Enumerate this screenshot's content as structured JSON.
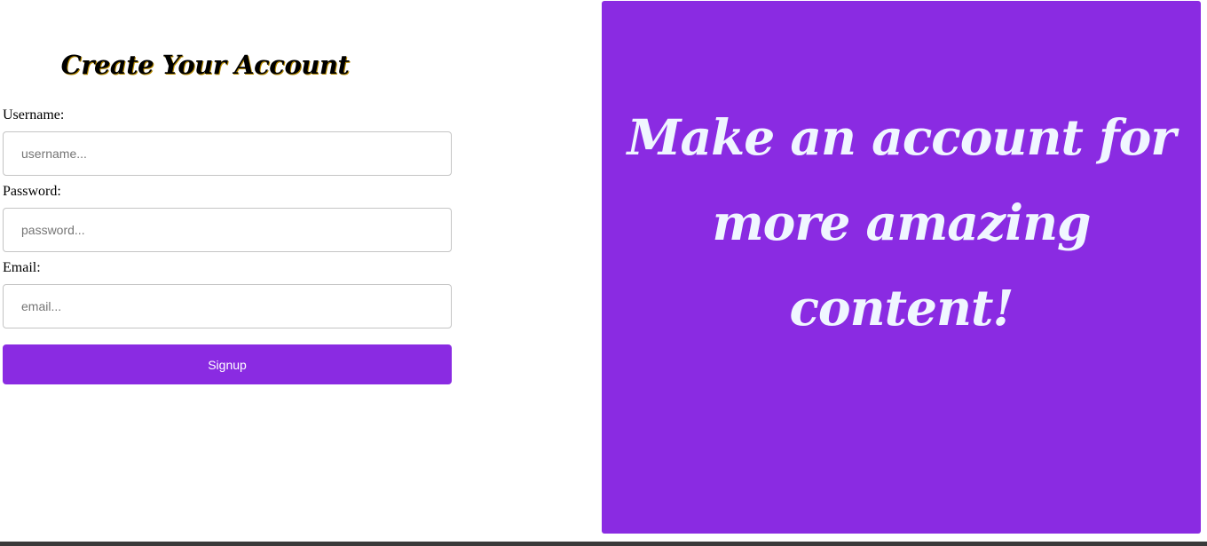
{
  "form": {
    "title": "Create Your Account",
    "username": {
      "label": "Username:",
      "placeholder": "username..."
    },
    "password": {
      "label": "Password:",
      "placeholder": "password..."
    },
    "email": {
      "label": "Email:",
      "placeholder": "email..."
    },
    "submit_label": "Signup"
  },
  "promo": {
    "text": "Make an account for more amazing content!"
  },
  "colors": {
    "accent": "#8a2be2",
    "promo_text": "#f0f6ff"
  }
}
